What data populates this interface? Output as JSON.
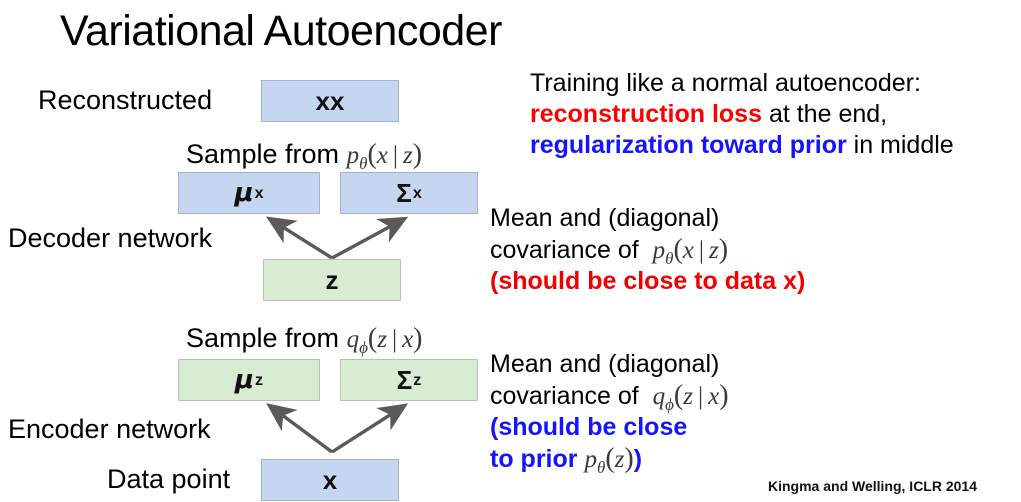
{
  "title": "Variational Autoencoder",
  "citation": "Kingma and Welling, ICLR 2014",
  "colors": {
    "box_blue_fill": "#c6d6f0",
    "box_blue_border": "#a6b3c9",
    "box_green_fill": "#d7ecd2",
    "box_green_border": "#b2c4ad",
    "arrow": "#5a5a5a",
    "accent_red": "#ff0000",
    "accent_blue": "#1414ff",
    "text": "#000000"
  },
  "labels": {
    "reconstructed": "Reconstructed",
    "decoder_network": "Decoder network",
    "encoder_network": "Encoder network",
    "data_point": "Data point"
  },
  "sample_rows": {
    "decoder": {
      "prefix": "Sample from",
      "dist_letter": "p",
      "dist_sub": "θ",
      "open": "(",
      "var_left": "x",
      "bar": "|",
      "var_right": "z",
      "close": ")"
    },
    "encoder": {
      "prefix": "Sample from",
      "dist_letter": "q",
      "dist_sub": "ϕ",
      "open": "(",
      "var_left": "z",
      "bar": "|",
      "var_right": "x",
      "close": ")"
    }
  },
  "boxes": {
    "recon_x": {
      "text": "xx",
      "color": "blue"
    },
    "mu_x": {
      "sym": "μ",
      "sup": "x",
      "color": "blue"
    },
    "sigma_x": {
      "sym": "Σ",
      "sup": "x",
      "color": "blue"
    },
    "z": {
      "text": "z",
      "color": "green"
    },
    "mu_z": {
      "sym": "μ",
      "sup": "z",
      "color": "green"
    },
    "sigma_z": {
      "sym": "Σ",
      "sup": "z",
      "color": "green"
    },
    "x": {
      "text": "x",
      "color": "blue"
    }
  },
  "training_note": {
    "line1": "Training like a normal autoencoder:",
    "line2_red": "reconstruction loss",
    "line2_rest": " at the end,",
    "line3_blue": "regularization toward prior",
    "line3_rest": " in middle"
  },
  "decoder_note": {
    "line1": "Mean and (diagonal)",
    "line2_prefix": "covariance of",
    "math": {
      "dist_letter": "p",
      "dist_sub": "θ",
      "open": "(",
      "var_left": "x",
      "bar": "|",
      "var_right": "z",
      "close": ")"
    },
    "line3_red": "(should be close to data x)"
  },
  "encoder_note": {
    "line1": "Mean and (diagonal)",
    "line2_prefix": "covariance of",
    "math": {
      "dist_letter": "q",
      "dist_sub": "ϕ",
      "open": "(",
      "var_left": "z",
      "bar": "|",
      "var_right": "x",
      "close": ")"
    },
    "line3_blue": "(should be close",
    "line4_blue_prefix": "to prior",
    "line4_math": {
      "dist_letter": "p",
      "dist_sub": "θ",
      "open": "(",
      "var": "z",
      "close": ")"
    },
    "line4_suffix": ")"
  }
}
